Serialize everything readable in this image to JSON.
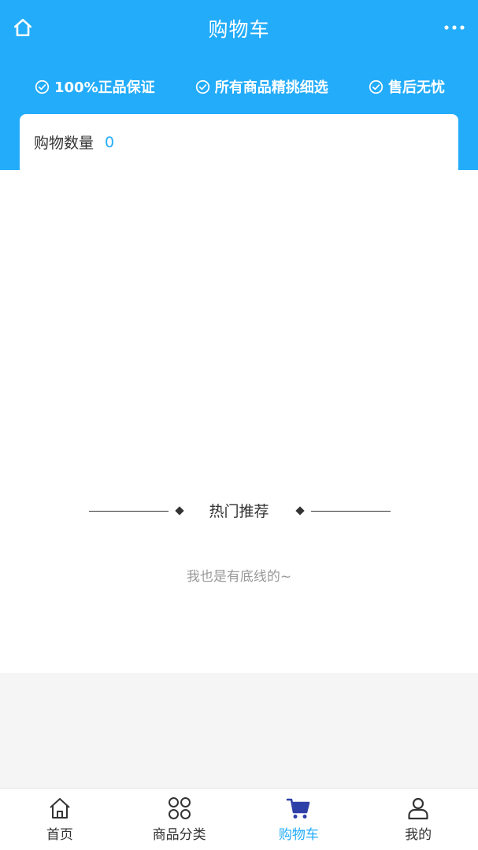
{
  "header": {
    "title": "购物车",
    "home_icon": "home-icon",
    "more_icon": "more-icon"
  },
  "guarantees": [
    {
      "icon": "check-circle-icon",
      "label": "100%正品保证"
    },
    {
      "icon": "check-circle-icon",
      "label": "所有商品精挑细选"
    },
    {
      "icon": "check-circle-icon",
      "label": "售后无忧"
    }
  ],
  "cart": {
    "count_label": "购物数量",
    "count_value": "0"
  },
  "recommend": {
    "title": "热门推荐",
    "end_text": "我也是有底线的~"
  },
  "tabbar": {
    "active_index": 2,
    "items": [
      {
        "label": "首页",
        "icon": "home-icon"
      },
      {
        "label": "商品分类",
        "icon": "category-icon"
      },
      {
        "label": "购物车",
        "icon": "cart-icon"
      },
      {
        "label": "我的",
        "icon": "user-icon"
      }
    ]
  },
  "colors": {
    "accent": "#23acfa",
    "cart_icon_active": "#2f3fa8",
    "text": "#333333",
    "muted": "#999999",
    "background": "#f5f5f5"
  }
}
